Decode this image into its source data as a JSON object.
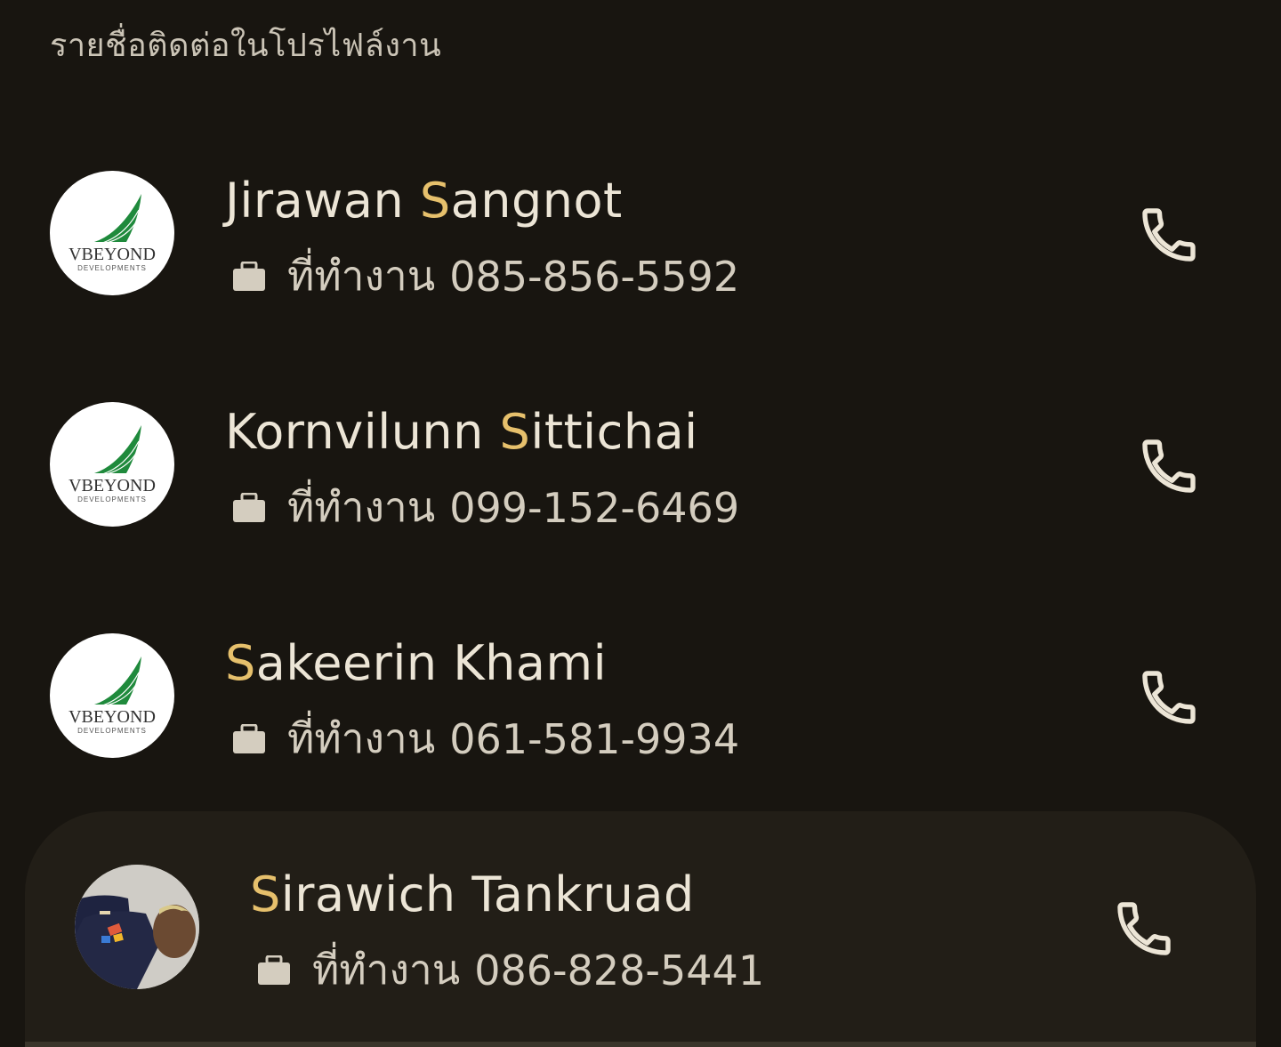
{
  "section": {
    "title": "รายชื่อติดต่อในโปรไฟล์งาน"
  },
  "contacts": [
    {
      "highlight_char": "S",
      "name_before": "Jirawan ",
      "name_after": "angnot",
      "phone_label": "ที่ทำงาน",
      "phone": "085-856-5592",
      "avatar": "vbeyond-logo",
      "logo_text": "VBEYOND",
      "logo_subtext": "DEVELOPMENTS"
    },
    {
      "highlight_char": "S",
      "name_before": "Kornvilunn ",
      "name_after": "ittichai",
      "phone_label": "ที่ทำงาน",
      "phone": "099-152-6469",
      "avatar": "vbeyond-logo",
      "logo_text": "VBEYOND",
      "logo_subtext": "DEVELOPMENTS"
    },
    {
      "highlight_char": "S",
      "name_before": "",
      "name_after": "akeerin Khami",
      "phone_label": "ที่ทำงาน",
      "phone": "061-581-9934",
      "avatar": "vbeyond-logo",
      "logo_text": "VBEYOND",
      "logo_subtext": "DEVELOPMENTS"
    },
    {
      "highlight_char": "S",
      "name_before": "",
      "name_after": "irawich Tankruad",
      "phone_label": "ที่ทำงาน",
      "phone": "086-828-5441",
      "avatar": "person-photo",
      "selected": true
    }
  ],
  "icons": {
    "call": "phone-icon",
    "work": "briefcase-icon"
  },
  "colors": {
    "background": "#181510",
    "highlight": "#e6c06c",
    "text": "#ece5d6",
    "selected_card": "#221e17",
    "logo_green": "#1f8a3c"
  }
}
